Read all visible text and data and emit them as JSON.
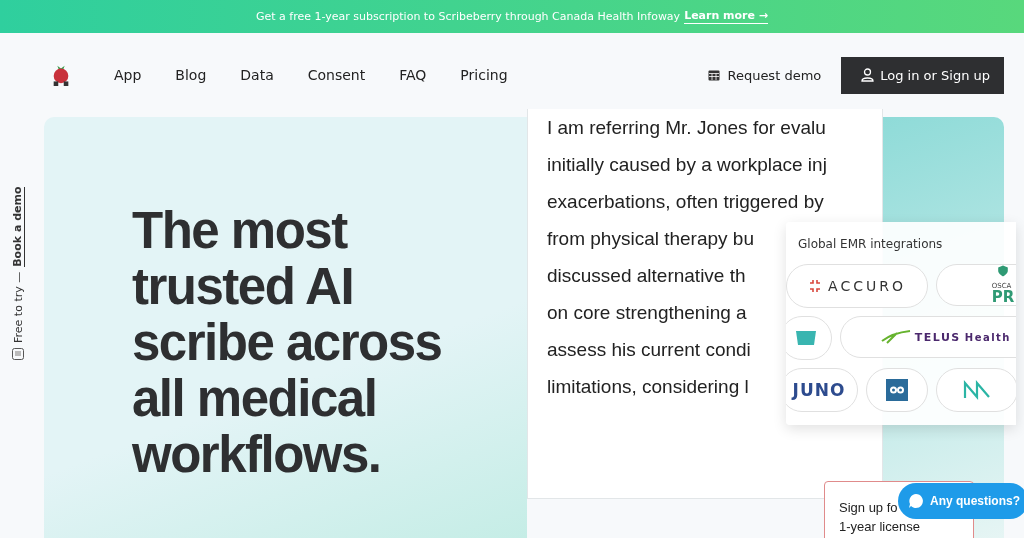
{
  "banner": {
    "text": "Get a free 1-year subscription to Scribeberry through Canada Health Infoway",
    "link": "Learn more",
    "arrow": "→"
  },
  "nav": {
    "items": [
      {
        "label": "App"
      },
      {
        "label": "Blog"
      },
      {
        "label": "Data"
      },
      {
        "label": "Consent"
      },
      {
        "label": "FAQ"
      },
      {
        "label": "Pricing"
      }
    ],
    "request_demo": "Request demo",
    "login": "Log in or Sign up"
  },
  "side_tab": {
    "text": "Free to try —",
    "link": "Book a demo"
  },
  "hero": {
    "headline": "The most trusted AI scribe across all medical workflows."
  },
  "document": {
    "lines": [
      "I am referring Mr. Jones for evalu",
      "initially caused by a workplace inj",
      "exacerbations, often triggered by",
      "from physical therapy bu",
      "discussed alternative th",
      "on core strengthening a",
      "assess his current condi",
      "limitations, considering l"
    ]
  },
  "integrations": {
    "title": "Global EMR integrations",
    "rows": [
      [
        {
          "kind": "accuro",
          "text": "ACCURO"
        },
        {
          "kind": "oscar",
          "text": "OSCA",
          "sub": "PR"
        }
      ],
      [
        {
          "kind": "badge"
        },
        {
          "kind": "telus",
          "text": "TELUS",
          "sub": "Health"
        }
      ],
      [
        {
          "kind": "juno",
          "text": "JUNO"
        },
        {
          "kind": "owl"
        },
        {
          "kind": "wave"
        }
      ]
    ]
  },
  "signup": {
    "lines": [
      "Sign up fo",
      "1-year license"
    ]
  },
  "chat": {
    "label": "Any questions?"
  }
}
